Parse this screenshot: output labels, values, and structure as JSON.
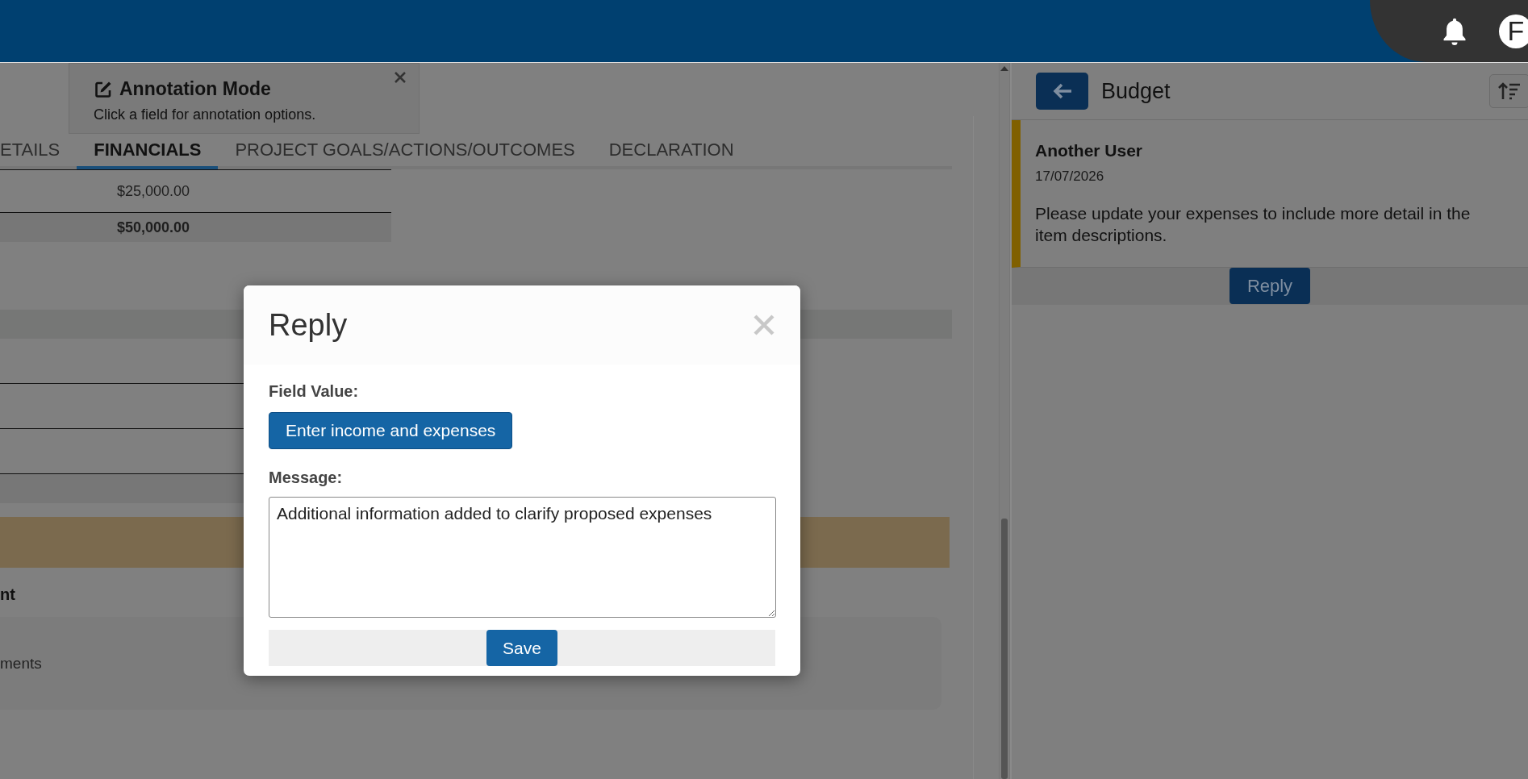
{
  "header": {
    "avatar_initial": "F"
  },
  "annotation_banner": {
    "title": "Annotation Mode",
    "text": "Click a field for annotation options."
  },
  "tabs": [
    {
      "label": "ETAILS",
      "selected": false
    },
    {
      "label": "FINANCIALS",
      "selected": true
    },
    {
      "label": "PROJECT GOALS/ACTIONS/OUTCOMES",
      "selected": false
    },
    {
      "label": "DECLARATION",
      "selected": false
    }
  ],
  "financials_table": {
    "rows": [
      {
        "kind": "amount",
        "value": "$25,000.00"
      },
      {
        "kind": "total",
        "value": "$50,000.00"
      }
    ]
  },
  "section_heading": "nt",
  "card_text": "ments",
  "comments_panel": {
    "title": "Budget",
    "comments": [
      {
        "author": "Another User",
        "date": "17/07/2026",
        "text": "Please update your expenses to include more detail in the item descriptions."
      }
    ],
    "reply_button": "Reply"
  },
  "reply_dialog": {
    "title": "Reply",
    "field_value_label": "Field Value:",
    "field_value_button": "Enter income and expenses",
    "message_label": "Message:",
    "message": "Additional information added to clarify proposed expenses",
    "save_button": "Save"
  }
}
